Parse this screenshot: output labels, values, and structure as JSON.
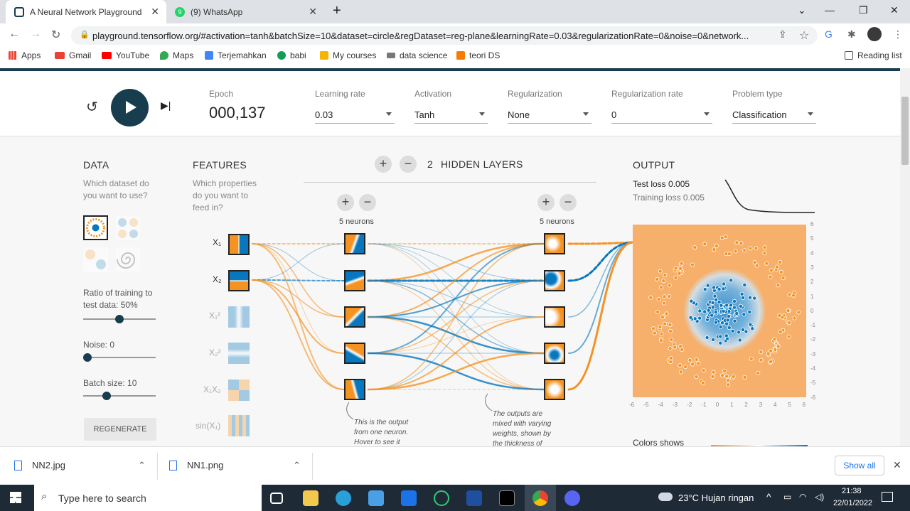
{
  "browser": {
    "tabs": [
      {
        "title": "A Neural Network Playground"
      },
      {
        "title": "(9) WhatsApp"
      }
    ],
    "url": "playground.tensorflow.org/#activation=tanh&batchSize=10&dataset=circle&regDataset=reg-plane&learningRate=0.03&regularizationRate=0&noise=0&network...",
    "bookmarks": [
      "Apps",
      "Gmail",
      "YouTube",
      "Maps",
      "Terjemahkan",
      "babi",
      "My courses",
      "data science",
      "teori DS"
    ],
    "reading_list": "Reading list"
  },
  "controls": {
    "epoch_label": "Epoch",
    "epoch_value": "000,137",
    "learning_rate_label": "Learning rate",
    "learning_rate_value": "0.03",
    "activation_label": "Activation",
    "activation_value": "Tanh",
    "regularization_label": "Regularization",
    "regularization_value": "None",
    "reg_rate_label": "Regularization rate",
    "reg_rate_value": "0",
    "problem_label": "Problem type",
    "problem_value": "Classification"
  },
  "data_panel": {
    "heading": "DATA",
    "question": "Which dataset do you want to use?",
    "ratio_label": "Ratio of training to test data:  50%",
    "ratio_value": 0.5,
    "noise_label": "Noise:  0",
    "noise_value": 0,
    "batch_label": "Batch size:  10",
    "batch_value": 0.3,
    "regenerate": "REGENERATE"
  },
  "features_panel": {
    "heading": "FEATURES",
    "question": "Which properties do you want to feed in?",
    "features": [
      "X₁",
      "X₂",
      "X₁²",
      "X₂²",
      "X₁X₂",
      "sin(X₁)"
    ]
  },
  "network": {
    "hidden_layers_count": "2",
    "hidden_layers_label": "HIDDEN LAYERS",
    "layer1_neurons": "5 neurons",
    "layer2_neurons": "5 neurons",
    "note1": "This is the output from one neuron. Hover to see it",
    "note2": "The outputs are mixed with varying weights, shown by the thickness of"
  },
  "output_panel": {
    "heading": "OUTPUT",
    "test_loss": "Test loss 0.005",
    "training_loss": "Training loss 0.005",
    "colors_shows": "Colors shows",
    "y_ticks": [
      "6",
      "5",
      "4",
      "3",
      "2",
      "1",
      "0",
      "-1",
      "-2",
      "-3",
      "-4",
      "-5",
      "-6"
    ],
    "x_ticks": [
      "-6",
      "-5",
      "-4",
      "-3",
      "-2",
      "-1",
      "0",
      "1",
      "2",
      "3",
      "4",
      "5",
      "6"
    ]
  },
  "downloads": {
    "items": [
      "NN2.jpg",
      "NN1.png"
    ],
    "show_all": "Show all"
  },
  "taskbar": {
    "search_placeholder": "Type here to search",
    "weather": "23°C  Hujan ringan",
    "time": "21:38",
    "date": "22/01/2022"
  },
  "colors": {
    "orange": "#f59322",
    "blue": "#0877bd",
    "dark": "#183d4e"
  }
}
